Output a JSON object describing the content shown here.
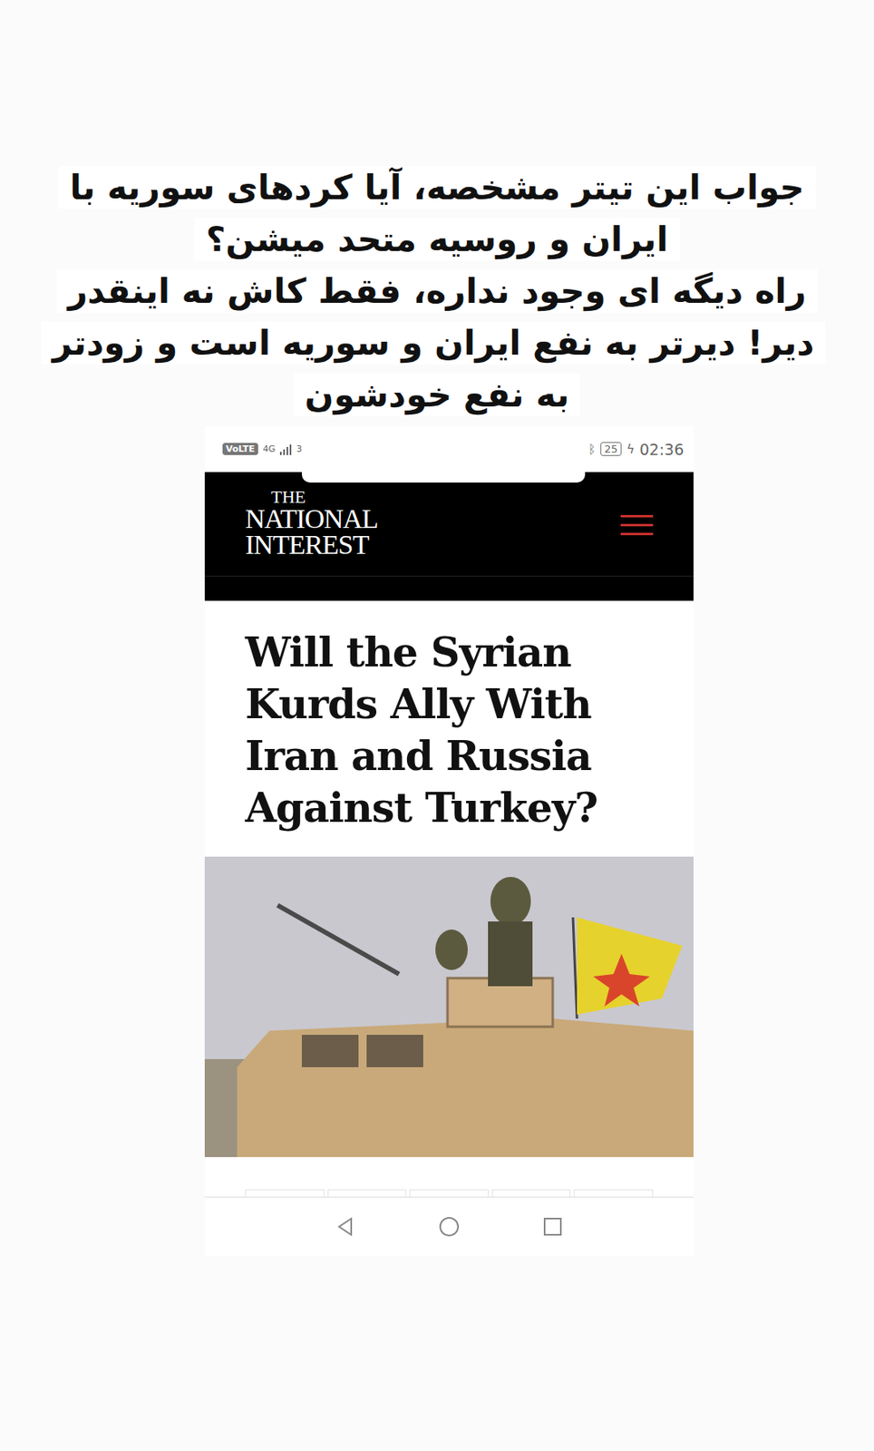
{
  "caption": {
    "paragraphs": [
      "جواب این تیتر مشخصه، آیا کردهای سوریه با ایران و روسیه متحد میشن؟",
      "راه دیگه ای وجود نداره، فقط کاش نه اینقدر دیر! دیرتر به نفع ایران و سوریه است و زودتر به نفع خودشون"
    ]
  },
  "phone": {
    "status_bar": {
      "network": [
        "VoLTE",
        "4G",
        "3G"
      ],
      "battery": "25",
      "time": "02:36"
    },
    "site": {
      "logo": [
        "THE",
        "NATIONAL",
        "INTEREST"
      ]
    },
    "article": {
      "headline": "Will the Syrian Kurds Ally With Iran and Russia Against Turkey?"
    }
  }
}
